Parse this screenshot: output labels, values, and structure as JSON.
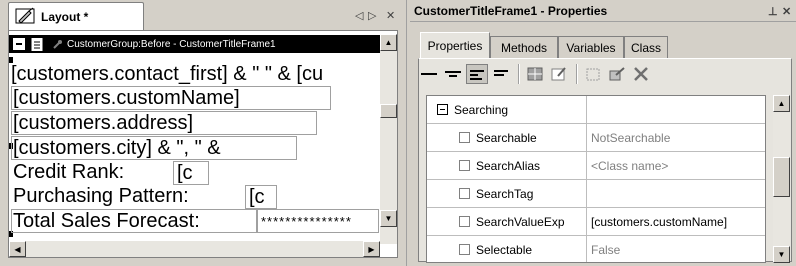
{
  "left": {
    "tab_label": "Layout *",
    "ctrl_prev": "◁",
    "ctrl_next": "▷",
    "ctrl_close": "✕",
    "band_label": "CustomerGroup:Before - CustomerTitleFrame1",
    "fields": [
      "[customers.contact_first] & \"  \" & [cu",
      "[customers.customName]",
      "[customers.address]",
      "[customers.city] & \", \" &",
      "Credit Rank:",
      "[c",
      "Purchasing Pattern:",
      "[c",
      "Total Sales Forecast:",
      "***************"
    ]
  },
  "right": {
    "title": "CustomerTitleFrame1 - Properties",
    "pin": "⊥",
    "close": "✕",
    "tabs": [
      "Properties",
      "Methods",
      "Variables",
      "Class"
    ],
    "active_tab": "Properties",
    "rows": [
      {
        "name": "Searching",
        "value": "",
        "group": true
      },
      {
        "name": "Searchable",
        "value": "NotSearchable",
        "dark": false
      },
      {
        "name": "SearchAlias",
        "value": "<Class name>",
        "dark": false
      },
      {
        "name": "SearchTag",
        "value": "",
        "dark": false
      },
      {
        "name": "SearchValueExp",
        "value": "[customers.customName]",
        "dark": true
      },
      {
        "name": "Selectable",
        "value": "False",
        "dark": false
      }
    ]
  },
  "colors": {
    "band_bg": "#000000",
    "panel_bg": "#d4d0c8",
    "grid_bg": "#ffffff"
  }
}
